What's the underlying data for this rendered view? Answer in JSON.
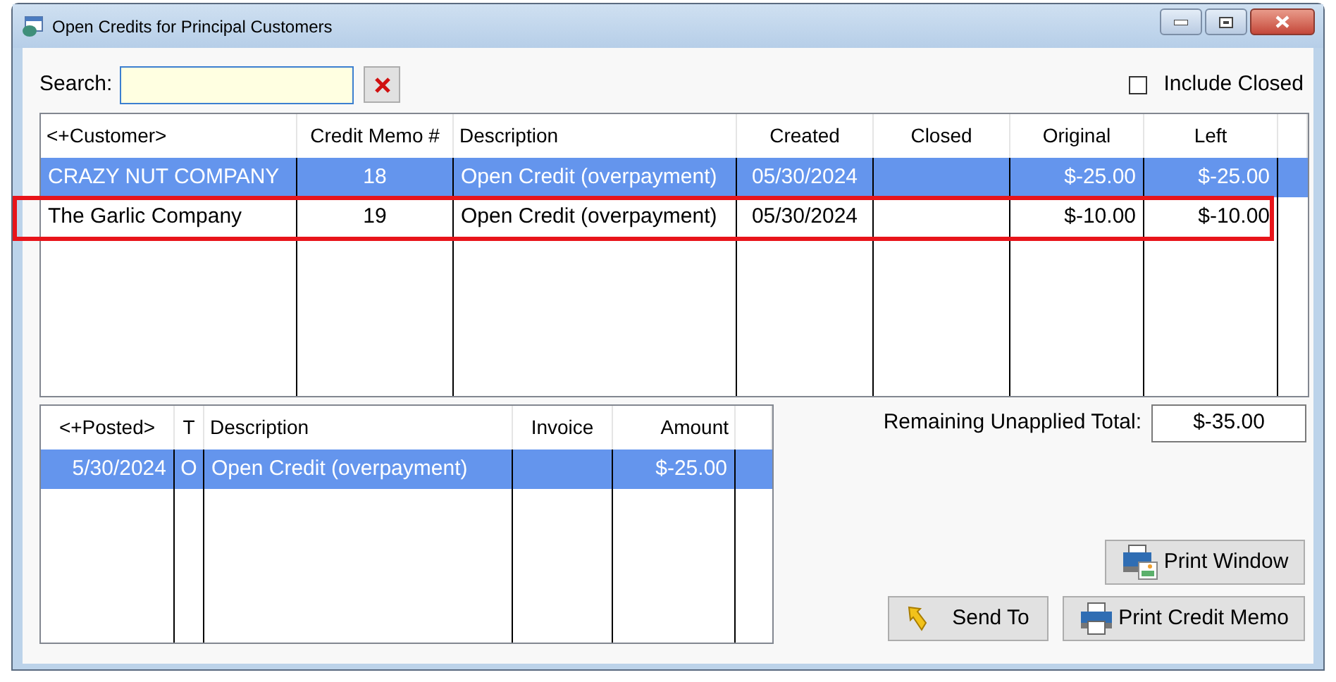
{
  "window": {
    "title": "Open Credits for Principal Customers"
  },
  "search": {
    "label": "Search:"
  },
  "include_closed": {
    "label": "Include Closed",
    "checked": false
  },
  "credits_table": {
    "columns": [
      "<+Customer>",
      "Credit Memo #",
      "Description",
      "Created",
      "Closed",
      "Original",
      "Left"
    ],
    "rows": [
      {
        "cells": [
          "CRAZY NUT COMPANY",
          "18",
          "Open Credit (overpayment)",
          "05/30/2024",
          "",
          "$-25.00",
          "$-25.00"
        ],
        "selected": true,
        "highlighted": false
      },
      {
        "cells": [
          "The Garlic Company",
          "19",
          "Open Credit (overpayment)",
          "05/30/2024",
          "",
          "$-10.00",
          "$-10.00"
        ],
        "selected": false,
        "highlighted": true
      }
    ]
  },
  "postings_table": {
    "columns": [
      "<+Posted>",
      "T",
      "Description",
      "Invoice",
      "Amount"
    ],
    "rows": [
      {
        "cells": [
          "5/30/2024",
          "O",
          "Open Credit (overpayment)",
          "",
          "$-25.00"
        ],
        "selected": true
      }
    ]
  },
  "remaining": {
    "label": "Remaining Unapplied Total:",
    "value": "$-35.00"
  },
  "buttons": [
    {
      "kind": "print-window",
      "label": "Print Window"
    },
    {
      "kind": "send",
      "label": "Send To"
    },
    {
      "kind": "print",
      "label": "Print Credit Memo"
    }
  ]
}
